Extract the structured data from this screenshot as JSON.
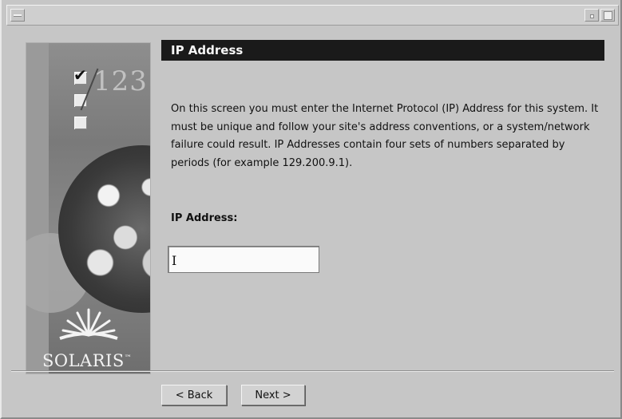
{
  "window": {
    "menu_icon": "window-menu-icon",
    "minimize_icon": "minimize-icon",
    "maximize_icon": "maximize-icon"
  },
  "sidebar": {
    "progress_numbers": "123",
    "checkboxes": [
      "checked",
      "unchecked",
      "unchecked"
    ],
    "logo_text": "SOLARIS",
    "logo_mark": "™"
  },
  "header": {
    "title": "IP Address"
  },
  "content": {
    "description": "On this screen you must enter the Internet Protocol (IP) Address for this system.  It must be unique and follow your site's address conventions, or a system/network failure could result.  IP Addresses contain four sets of numbers separated by periods (for example 129.200.9.1).",
    "field_label": "IP Address:",
    "field_value": ""
  },
  "buttons": {
    "back_label": "< Back",
    "next_label": "Next >"
  },
  "colors": {
    "header_bg": "#1a1a1a",
    "window_bg": "#c6c6c6"
  }
}
